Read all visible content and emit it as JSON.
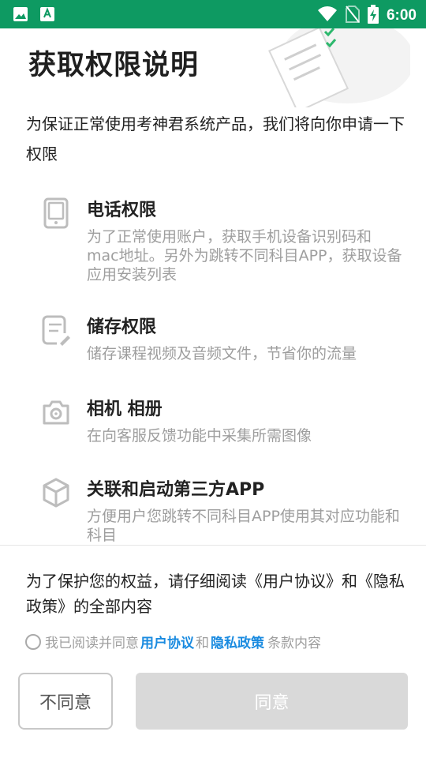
{
  "status_bar": {
    "time": "6:00",
    "icons": [
      "image-icon",
      "a-letter-icon",
      "wifi-icon",
      "no-sim-icon",
      "battery-charging-icon"
    ]
  },
  "page": {
    "title": "获取权限说明",
    "intro": "为保证正常使用考神君系统产品，我们将向你申请一下权限"
  },
  "permissions": [
    {
      "icon": "phone-icon",
      "title": "电话权限",
      "desc": "为了正常使用账户，获取手机设备识别码和mac地址。另外为跳转不同科目APP，获取设备应用安装列表"
    },
    {
      "icon": "storage-icon",
      "title": "储存权限",
      "desc": "储存课程视频及音频文件，节省你的流量"
    },
    {
      "icon": "camera-icon",
      "title": "相机 相册",
      "desc": "在向客服反馈功能中采集所需图像"
    },
    {
      "icon": "cube-icon",
      "title": "关联和启动第三方APP",
      "desc": "方便用户您跳转不同科目APP使用其对应功能和科目"
    }
  ],
  "notice": "为了保护您的权益，请仔细阅读《用户协议》和《隐私政策》的全部内容",
  "agreement": {
    "prefix": "我已阅读并同意",
    "user_agreement": "用户协议",
    "and": "和",
    "privacy_policy": "隐私政策",
    "suffix": "条款内容"
  },
  "buttons": {
    "disagree": "不同意",
    "agree": "同意"
  },
  "colors": {
    "status_bar": "#0e9a62",
    "link": "#1a8be0",
    "agree_button_disabled": "#d9d9d9"
  }
}
